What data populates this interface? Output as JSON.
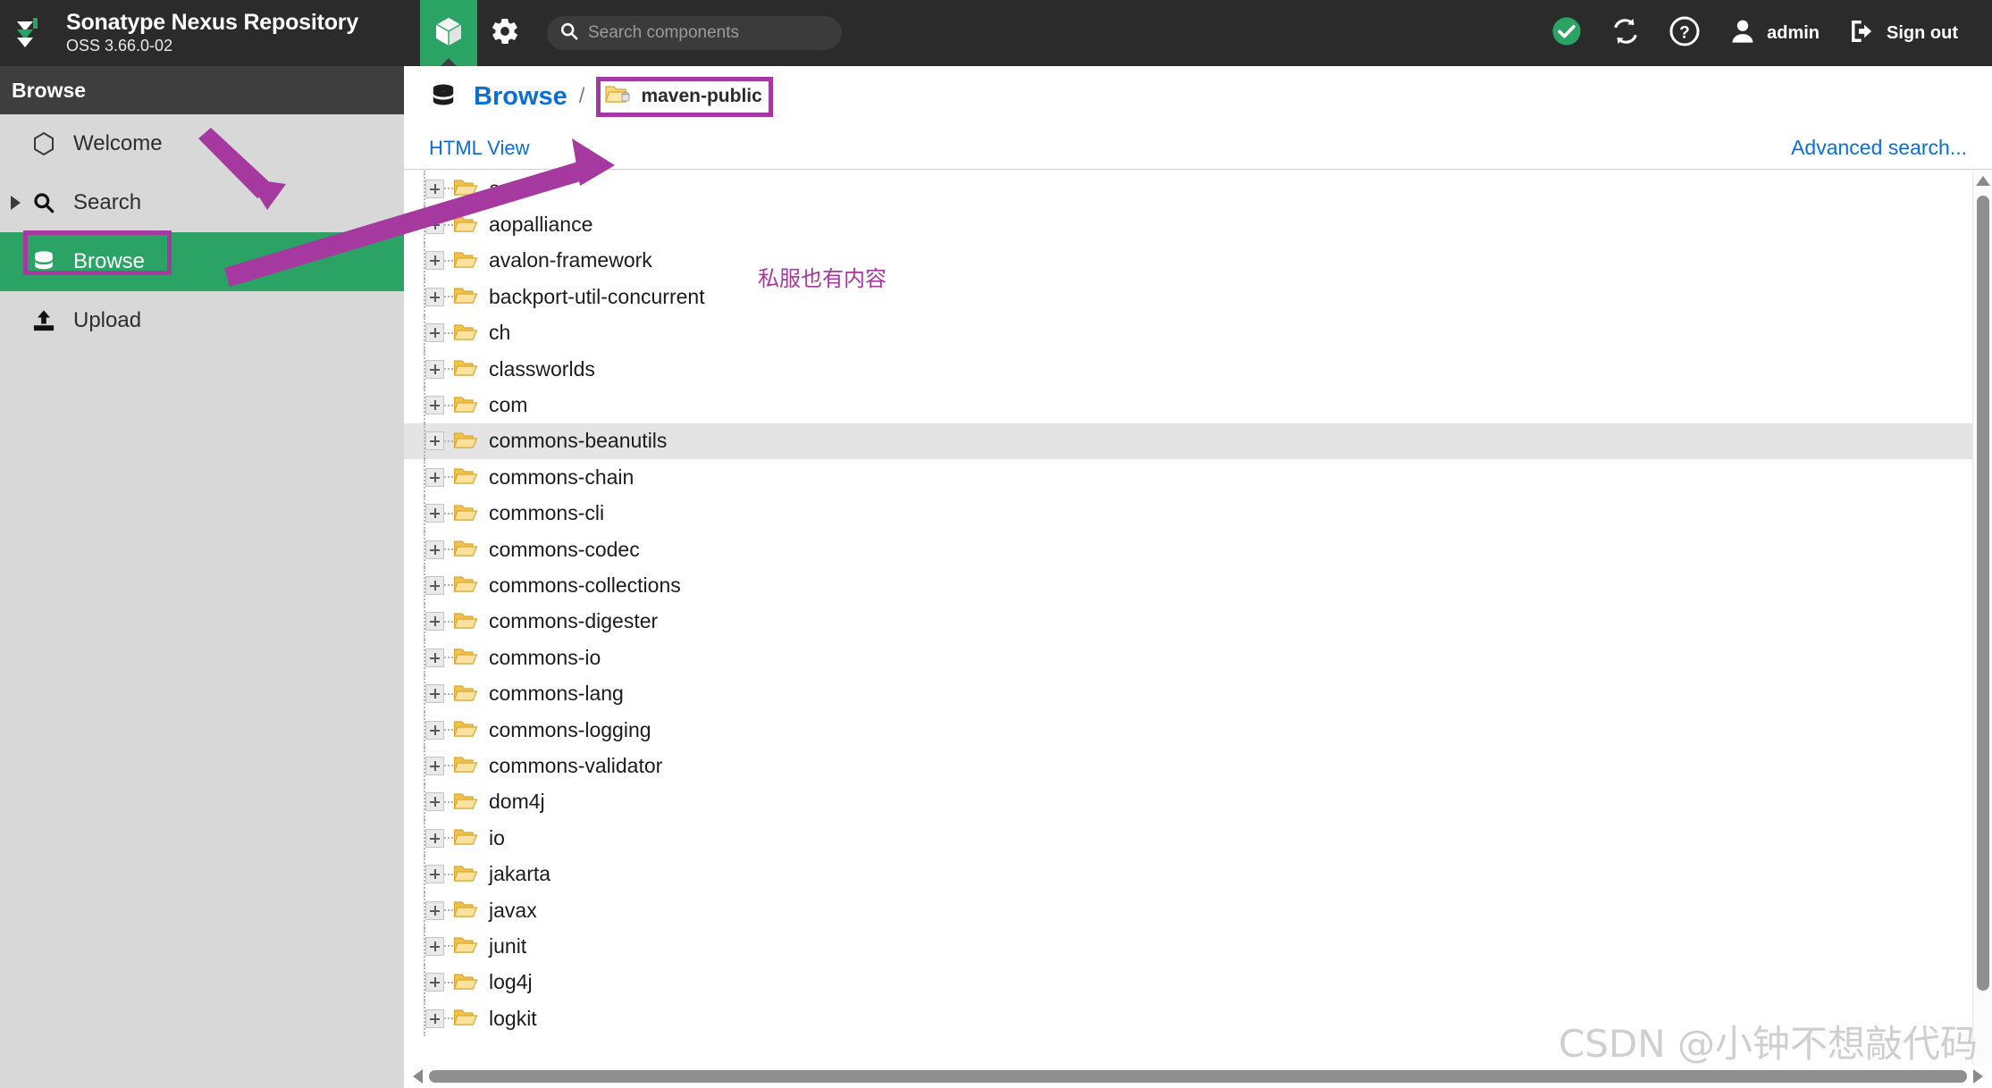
{
  "header": {
    "brand_title": "Sonatype Nexus Repository",
    "brand_subtitle": "OSS 3.66.0-02",
    "logo_icon": "nexus-logo-icon",
    "cube_tab_icon": "cube-icon",
    "settings_icon": "gear-icon",
    "search": {
      "icon": "search-icon",
      "placeholder": "Search components",
      "value": ""
    },
    "status_icon": "check-circle-icon",
    "refresh_icon": "refresh-icon",
    "help_icon": "help-circle-icon",
    "user_icon": "user-avatar-icon",
    "user_label": "admin",
    "signout_icon": "sign-out-icon",
    "signout_label": "Sign out"
  },
  "sidebar": {
    "section_title": "Browse",
    "items": [
      {
        "label": "Welcome",
        "icon": "hexagon-icon",
        "active": false,
        "expandable": false
      },
      {
        "label": "Search",
        "icon": "search-icon",
        "active": false,
        "expandable": true
      },
      {
        "label": "Browse",
        "icon": "database-icon",
        "active": true,
        "expandable": false
      },
      {
        "label": "Upload",
        "icon": "upload-icon",
        "active": false,
        "expandable": false
      }
    ]
  },
  "main": {
    "breadcrumb": {
      "root_icon": "database-icon",
      "root_label": "Browse",
      "separator": "/",
      "repo_icon": "repository-folder-icon",
      "repo_label": "maven-public"
    },
    "toolbar": {
      "html_view_label": "HTML View",
      "advanced_search_label": "Advanced search..."
    },
    "tree": {
      "expander_icon": "plus-box-icon",
      "folder_icon": "folder-icon",
      "highlighted_index": 7,
      "items": [
        "antlr",
        "aopalliance",
        "avalon-framework",
        "backport-util-concurrent",
        "ch",
        "classworlds",
        "com",
        "commons-beanutils",
        "commons-chain",
        "commons-cli",
        "commons-codec",
        "commons-collections",
        "commons-digester",
        "commons-io",
        "commons-lang",
        "commons-logging",
        "commons-validator",
        "dom4j",
        "io",
        "jakarta",
        "javax",
        "junit",
        "log4j",
        "logkit"
      ]
    },
    "scrollbars": {
      "vertical_up_icon": "scroll-up-arrow-icon",
      "horizontal_left_icon": "scroll-left-arrow-icon",
      "horizontal_right_icon": "scroll-right-arrow-icon"
    }
  },
  "annotations": {
    "note_text": "私服也有内容",
    "color": "#a6399f",
    "arrow_to_search_icon": "annotation-arrow-icon",
    "arrow_to_breadcrumb_icon": "annotation-arrow-icon",
    "box_browse_icon": "annotation-box-icon",
    "box_repo_icon": "annotation-box-icon"
  },
  "watermark": {
    "text": "CSDN @小钟不想敲代码"
  },
  "colors": {
    "header_bg": "#2b2b2b",
    "accent_green": "#2aa365",
    "sidebar_bg": "#d8d8d8",
    "link_blue": "#0b6fd4",
    "annotation_purple": "#a6399f",
    "folder_yellow": "#f2c14e"
  }
}
